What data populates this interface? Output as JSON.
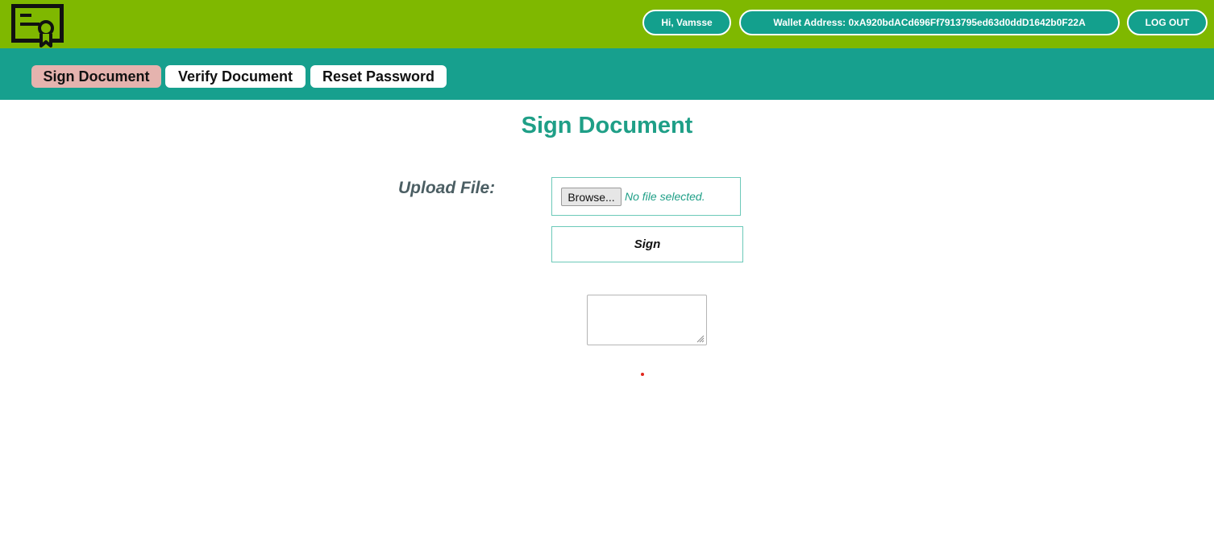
{
  "header": {
    "logo_icon": "certificate-document-icon",
    "greeting": "Hi, Vamsse",
    "wallet": "Wallet Address: 0xA920bdACd696Ff7913795ed63d0ddD1642b0F22A",
    "logout_label": "LOG OUT"
  },
  "nav": {
    "tabs": [
      {
        "label": "Sign Document",
        "active": true
      },
      {
        "label": "Verify Document",
        "active": false
      },
      {
        "label": "Reset Password",
        "active": false
      }
    ]
  },
  "main": {
    "title": "Sign Document",
    "upload_label": "Upload File:",
    "browse_label": "Browse...",
    "file_status": "No file selected.",
    "sign_label": "Sign",
    "result_value": ""
  },
  "colors": {
    "topbar": "#7fb800",
    "navbar": "#17a08e",
    "accent": "#1f9f87",
    "active_tab": "#e5b3ae",
    "error_dot": "#e0261d"
  }
}
